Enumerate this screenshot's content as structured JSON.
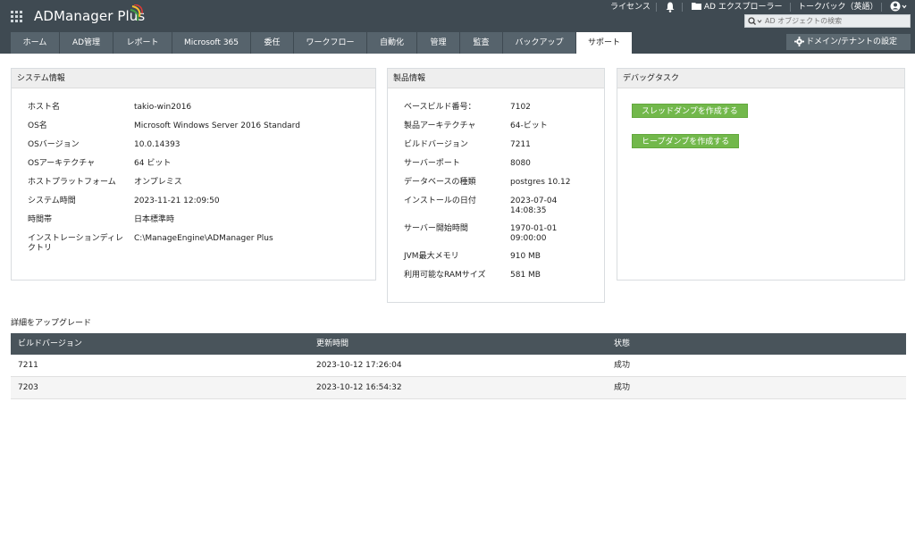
{
  "header": {
    "app_name": "ADManager Plus",
    "links": {
      "license": "ライセンス",
      "ad_explorer": "AD エクスプローラー",
      "talkback": "トークバック（英語）"
    },
    "search": {
      "placeholder": "AD オブジェクトの検索"
    },
    "icons": [
      "apps-grid-icon",
      "bell-icon",
      "folder-icon",
      "user-icon",
      "search-icon",
      "gear-icon"
    ]
  },
  "nav": {
    "tabs": [
      "ホーム",
      "AD管理",
      "レポート",
      "Microsoft 365",
      "委任",
      "ワークフロー",
      "自動化",
      "管理",
      "監査",
      "バックアップ",
      "サポート"
    ],
    "active_tab": "サポート",
    "domain_settings": "ドメイン/テナントの設定"
  },
  "system_info": {
    "title": "システム情報",
    "rows": [
      {
        "label": "ホスト名",
        "value": "takio-win2016"
      },
      {
        "label": "OS名",
        "value": "Microsoft Windows Server 2016 Standard"
      },
      {
        "label": "OSバージョン",
        "value": "10.0.14393"
      },
      {
        "label": "OSアーキテクチャ",
        "value": "64 ビット"
      },
      {
        "label": "ホストプラットフォーム",
        "value": "オンプレミス"
      },
      {
        "label": "システム時間",
        "value": "2023-11-21 12:09:50"
      },
      {
        "label": "時間帯",
        "value": "日本標準時"
      },
      {
        "label": "インストレーションディレクトリ",
        "value": "C:\\ManageEngine\\ADManager Plus"
      }
    ]
  },
  "product_info": {
    "title": "製品情報",
    "rows": [
      {
        "label": "ベースビルド番号：",
        "value": "7102"
      },
      {
        "label": "製品アーキテクチャ",
        "value": "64-ビット"
      },
      {
        "label": "ビルドバージョン",
        "value": "7211"
      },
      {
        "label": "サーバーポート",
        "value": "8080"
      },
      {
        "label": "データベースの種類",
        "value": "postgres 10.12"
      },
      {
        "label": "インストールの日付",
        "value": "2023-07-04\n14:08:35"
      },
      {
        "label": "サーバー開始時間",
        "value": "1970-01-01\n09:00:00"
      },
      {
        "label": "JVM最大メモリ",
        "value": "910 MB"
      },
      {
        "label": "利用可能なRAMサイズ",
        "value": "581 MB"
      }
    ]
  },
  "debug_tasks": {
    "title": "デバッグタスク",
    "thread_dump_button": "スレッドダンプを作成する",
    "heap_dump_button": "ヒープダンプを作成する"
  },
  "upgrade": {
    "title": "詳細をアップグレード",
    "columns": [
      "ビルドバージョン",
      "更新時間",
      "状態"
    ],
    "rows": [
      [
        "7211",
        "2023-10-12 17:26:04",
        "成功"
      ],
      [
        "7203",
        "2023-10-12 16:54:32",
        "成功"
      ]
    ]
  },
  "colors": {
    "header_bg": "#3f4a52",
    "tab_bg": "#56636c",
    "button_green": "#72b84b",
    "logo_swoosh": [
      "#e53935",
      "#fbc02d",
      "#43a047",
      "#1e88e5"
    ]
  }
}
